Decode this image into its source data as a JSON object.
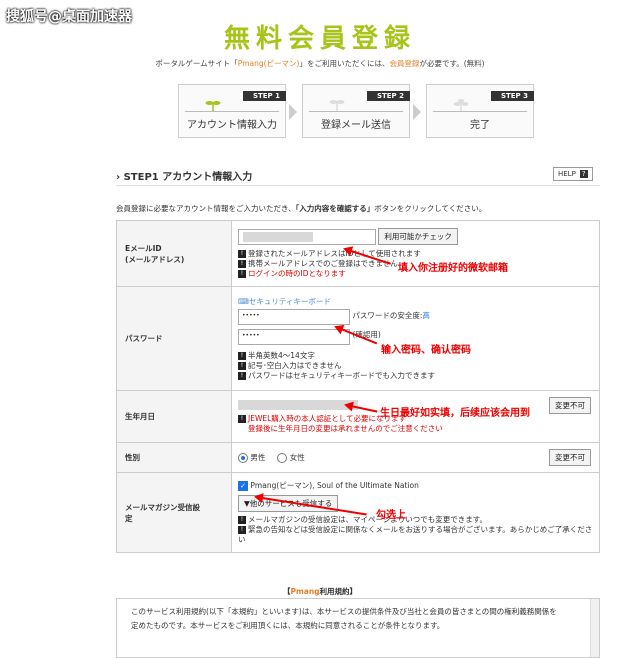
{
  "watermark": "搜狐号@桌面加速器",
  "page_title": "無料会員登録",
  "subtitle": {
    "pre": "ポータルゲームサイト「",
    "site": "Pmang(ピーマン)",
    "mid": "」をご利用いただくには、",
    "req": "会員登録",
    "post": "が必要です。(無料)"
  },
  "steps": [
    {
      "tag": "STEP 1",
      "label": "アカウント情報入力"
    },
    {
      "tag": "STEP 2",
      "label": "登録メール送信"
    },
    {
      "tag": "STEP 3",
      "label": "完了"
    }
  ],
  "section_title": "STEP1 アカウント情報入力",
  "help_label": "HELP",
  "help_icon": "?",
  "intro": {
    "pre": "会員登録に必要なアカウント情報をご入力いただき、",
    "bold": "「入力内容を確認する」",
    "post": "ボタンをクリックしてください。"
  },
  "email": {
    "label1": "EメールID",
    "label2": "(メールアドレス)",
    "check_button": "利用可能かチェック",
    "notes": [
      "登録されたメールアドレスはIDとして使用されます",
      "携帯メールアドレスでのご登録はできません",
      "ログインの時のIDとなります"
    ]
  },
  "password": {
    "label": "パスワード",
    "keyboard_link": "セキュリティキーボード",
    "value": "•••••",
    "confirm_value": "•••••",
    "strength_label": "パスワードの安全度:",
    "strength_value": "高",
    "confirm_label": "(確認用)",
    "notes": [
      "半角英数4～14文字",
      "記号･空白入力はできません",
      "パスワードはセキュリティキーボードでも入力できます"
    ]
  },
  "birthday": {
    "label": "生年月日",
    "change_button": "変更不可",
    "notes": [
      "JEWEL購入時の本人認証として必要になります",
      "登録後に生年月日の変更は承れませんのでご注意ください"
    ]
  },
  "gender": {
    "label": "性別",
    "male": "男性",
    "female": "女性",
    "change_button": "変更不可"
  },
  "newsletter": {
    "label1": "メールマガジン受信設",
    "label2": "定",
    "option": "Pmang(ピーマン), Soul of the Ultimate Nation",
    "other_button": "▼他のサービスも受信する",
    "notes": [
      "メールマガジンの受信設定は、マイページよりいつでも変更できます。",
      "緊急の告知などは受信設定に関係なくメールをお送りする場合がございます。あらかじめご了承ください"
    ]
  },
  "annotations": {
    "email": "填入你注册好的微软邮箱",
    "password": "输入密码、确认密码",
    "birthday": "生日最好如实填，后续应该会用到",
    "newsletter": "勾选上"
  },
  "terms": {
    "title_pre": "【",
    "title_brand": "Pmang",
    "title_post": "利用規約】",
    "line1": "このサービス利用規約(以下「本規約」といいます)は、本サービスの提供条件及び当社と会員の皆さまとの間の権利義務関係を",
    "line2": "定めたものです。本サービスをご利用頂くには、本規約に同意されることが条件となります。"
  },
  "colors": {
    "title_green": "#a8c31a",
    "accent_orange": "#e67e22",
    "annotation_red": "#e00000"
  }
}
